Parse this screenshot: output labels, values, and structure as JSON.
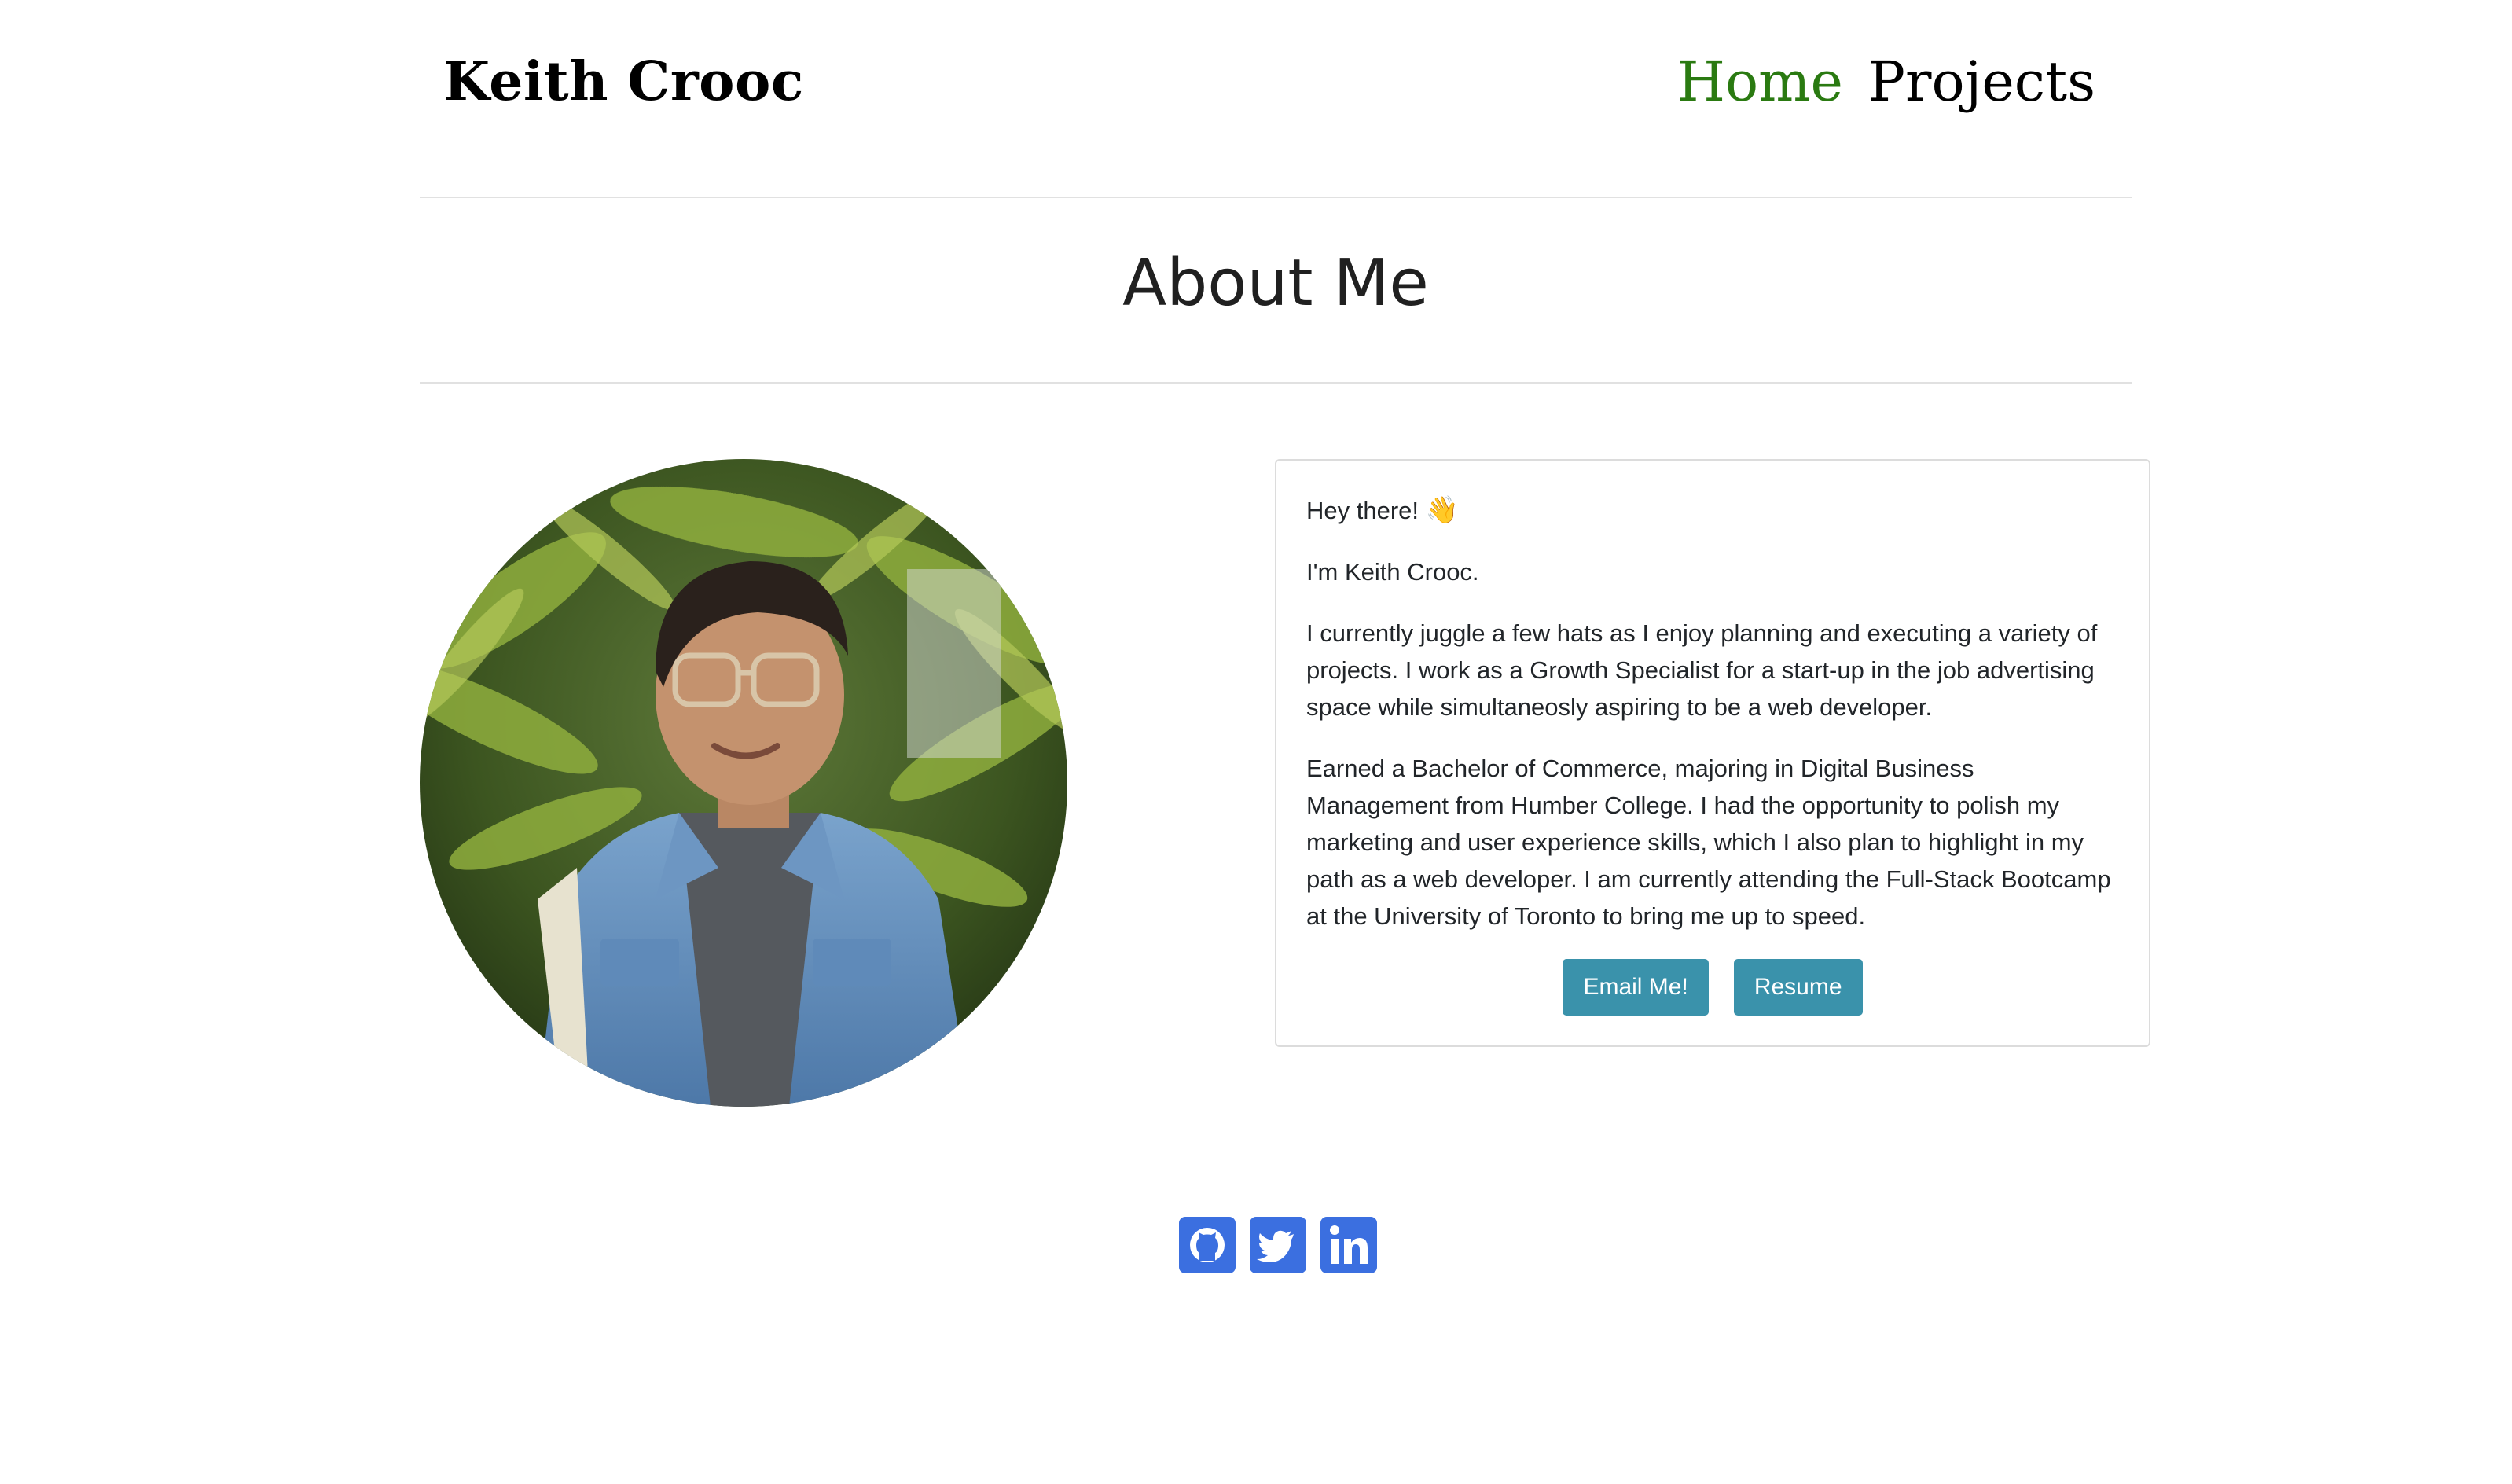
{
  "header": {
    "brand": "Keith Crooc",
    "nav": [
      {
        "label": "Home",
        "active": true
      },
      {
        "label": "Projects",
        "active": false
      }
    ],
    "active_color": "#2a7a11"
  },
  "main": {
    "title": "About Me",
    "portrait_icon": "portrait-photo",
    "card": {
      "greeting": "Hey there!",
      "greeting_emoji": "👋",
      "intro": "I'm Keith Crooc.",
      "paragraph1": "I currently juggle a few hats as I enjoy planning and executing a variety of projects. I work as a Growth Specialist for a start-up in the job advertising space while simultaneosly aspiring to be a web developer.",
      "paragraph2": "Earned a Bachelor of Commerce, majoring in Digital Business Management from Humber College. I had the opportunity to polish my marketing and user experience skills, which I also plan to highlight in my path as a web developer. I am currently attending the Full-Stack Bootcamp at the University of Toronto to bring me up to speed.",
      "buttons": {
        "email": "Email Me!",
        "resume": "Resume"
      },
      "button_color": "#3a92ab"
    }
  },
  "footer": {
    "social": [
      {
        "icon": "github-icon"
      },
      {
        "icon": "twitter-icon"
      },
      {
        "icon": "linkedin-icon"
      }
    ],
    "icon_color": "#3b6fe0"
  }
}
